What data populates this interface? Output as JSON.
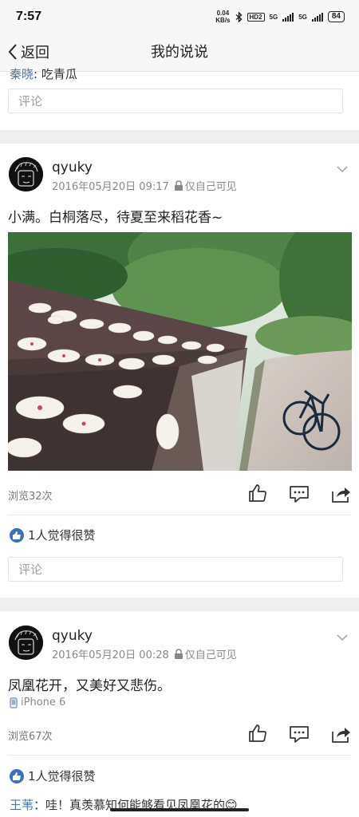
{
  "status_bar": {
    "time": "7:57",
    "net_speed": "0.04",
    "net_unit": "KB/s",
    "hd": "HD2",
    "signal1": "5G",
    "signal2": "5G",
    "battery": "84"
  },
  "nav": {
    "back_label": "返回",
    "title": "我的说说"
  },
  "top_partial_comment": {
    "user": "秦晓",
    "text": ": 吃青瓜"
  },
  "comment_placeholder": "评论",
  "posts": [
    {
      "username": "qyuky",
      "date": "2016年05月20日 09:17",
      "visibility": "仅自己可见",
      "text": "小满。白桐落尽，待夏至来稻花香~",
      "views": "浏览32次",
      "likes": "1人觉得很赞"
    },
    {
      "username": "qyuky",
      "date": "2016年05月20日 00:28",
      "visibility": "仅自己可见",
      "text": "凤凰花开，又美好又悲伤。",
      "device": "iPhone 6",
      "views": "浏览67次",
      "likes": "1人觉得很赞"
    }
  ],
  "bottom_partial_comment": {
    "user": "王苇",
    "text": "：哇！真羡慕知何能够看见凤凰花的😊"
  },
  "icons": {
    "back": "chevron-left-icon",
    "expand": "chevron-down-icon",
    "lock": "lock-icon",
    "like": "thumbs-up-icon",
    "comment": "comment-icon",
    "share": "share-icon",
    "phone": "phone-icon"
  },
  "colors": {
    "link_blue": "#4a74b2",
    "like_badge": "#3b71b8",
    "separator": "#efefef"
  }
}
